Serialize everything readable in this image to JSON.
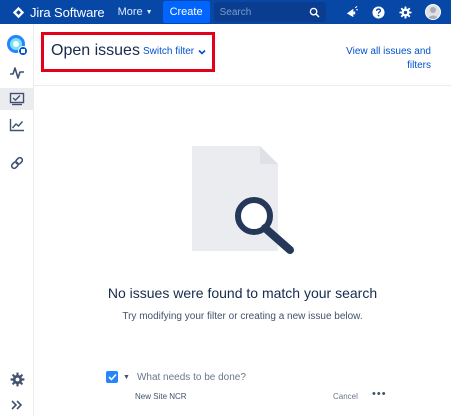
{
  "topbar": {
    "product_name": "Jira Software",
    "more_label": "More",
    "create_label": "Create",
    "search_placeholder": "Search"
  },
  "header": {
    "title": "Open issues",
    "switch_filter_label": "Switch filter",
    "view_all_label": "View all issues and filters"
  },
  "empty_state": {
    "title": "No issues were found to match your search",
    "subtitle": "Try modifying your filter or creating a new issue below."
  },
  "inline_create": {
    "placeholder": "What needs to be done?",
    "project_name": "New Site NCR",
    "cancel_label": "Cancel",
    "more_label": "•••"
  },
  "colors": {
    "nav_background": "#0747a6",
    "create_button": "#0065ff",
    "link": "#0052cc",
    "highlight_border": "#e3001b",
    "checkbox": "#2684ff"
  },
  "icons": {
    "sidebar": [
      "project-avatar-icon",
      "activity-icon",
      "board-icon",
      "reports-icon",
      "link-icon",
      "settings-icon",
      "expand-icon"
    ],
    "top": [
      "notifications-icon",
      "help-icon",
      "settings-icon",
      "user-avatar-icon"
    ]
  }
}
